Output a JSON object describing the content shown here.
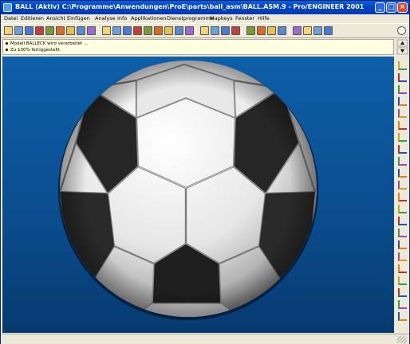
{
  "window": {
    "title": "BALL (Aktiv)  C:\\Programme\\Anwendungen\\ProE\\parts\\ball_asm\\BALL.ASM.9 - Pro/ENGINEER 2001",
    "min_label": "_",
    "max_label": "□",
    "close_label": "×"
  },
  "menu": {
    "items": [
      {
        "label": "Datei"
      },
      {
        "label": "Editieren"
      },
      {
        "label": "Ansicht"
      },
      {
        "label": "Einfügen"
      },
      {
        "label": "Analyse"
      },
      {
        "label": "Info"
      },
      {
        "label": "Applikationen"
      },
      {
        "label": "Dienstprogramme"
      },
      {
        "label": "Mapkeys"
      },
      {
        "label": "Fenster"
      },
      {
        "label": "Hilfe"
      }
    ]
  },
  "messages": [
    {
      "text": "Modell BALLECK wird verarbeitet ..."
    },
    {
      "text": "Zu 100% fertiggestellt."
    }
  ],
  "toolbar_icons": [
    "new-file-icon",
    "open-file-icon",
    "save-icon",
    "save-copy-icon",
    "print-icon",
    "erase-icon",
    "cut-icon",
    "copy-icon",
    "paste-icon",
    "repaint-icon",
    "orient-icon",
    "zoom-in-icon",
    "zoom-out-icon",
    "refit-icon",
    "spin-icon",
    "view-manager-icon",
    "saved-views-icon",
    "model-tree-icon",
    "wireframe-icon",
    "hidden-line-icon",
    "no-hidden-icon",
    "shading-icon",
    "datum-planes-icon",
    "datum-axes-icon",
    "datum-points-icon",
    "csys-icon",
    "regenerate-icon",
    "select-icon",
    "analysis-icon",
    "context-help-icon"
  ],
  "colors": {
    "titlebar": "#0046c8",
    "viewport_top": "#0d5fa8",
    "viewport_bottom": "#073a70",
    "message_bg": "#ffffe1"
  }
}
